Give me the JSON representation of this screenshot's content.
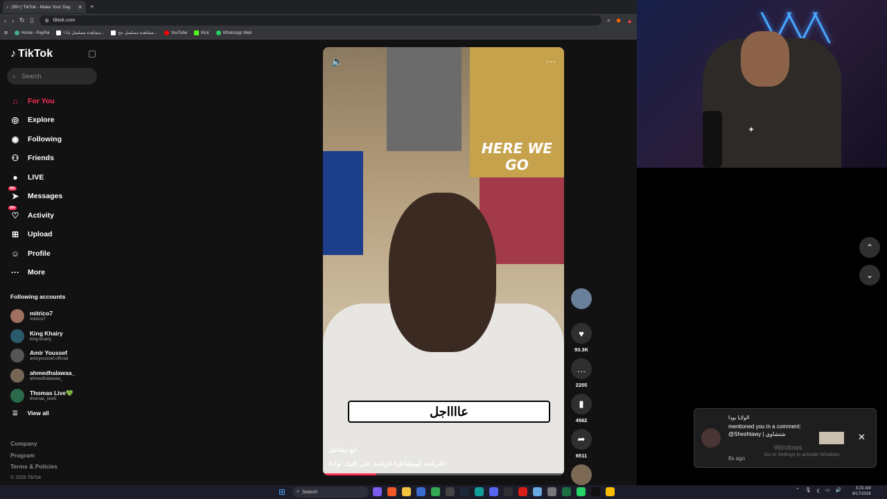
{
  "browser": {
    "tab_title": "(99+) TikTok - Make Your Day",
    "url": "tiktok.com",
    "bookmarks": [
      "Home - PayPal",
      "مشاهدة مسلسل بابا ا...",
      "مشاهدة مسلسل جح...",
      "YouTube",
      "Kick",
      "WhatsApp Web"
    ]
  },
  "sidebar": {
    "logo": "TikTok",
    "search_placeholder": "Search",
    "nav": [
      {
        "label": "For You",
        "icon": "home-icon",
        "active": true
      },
      {
        "label": "Explore",
        "icon": "compass-icon"
      },
      {
        "label": "Following",
        "icon": "following-icon"
      },
      {
        "label": "Friends",
        "icon": "friends-icon"
      },
      {
        "label": "LIVE",
        "icon": "live-icon"
      },
      {
        "label": "Messages",
        "icon": "messages-icon",
        "badge": "99+"
      },
      {
        "label": "Activity",
        "icon": "activity-icon",
        "badge": "99+"
      },
      {
        "label": "Upload",
        "icon": "upload-icon"
      },
      {
        "label": "Profile",
        "icon": "profile-icon"
      },
      {
        "label": "More",
        "icon": "more-icon"
      }
    ],
    "following_title": "Following accounts",
    "accounts": [
      {
        "name": "mitrico7",
        "handle": "mitrico7"
      },
      {
        "name": "King Khairy",
        "handle": "king.khairy"
      },
      {
        "name": "Amir Youssef",
        "handle": "amiryoussef.official"
      },
      {
        "name": "ahmedhalawaa_",
        "handle": "ahmedhalawaa_"
      },
      {
        "name": "Thomas Live💚",
        "handle": "thomas_live5"
      }
    ],
    "view_all": "View all",
    "footer": [
      "Company",
      "Program",
      "Terms & Policies"
    ],
    "copyright": "© 2026 TikTok"
  },
  "video": {
    "poster_text": "HERE WE GO",
    "caption": "عااااجل",
    "author": "ابو مشاعل",
    "hashtags": "#الرياضة_أبومشاعل# الرياضة_على_التيك_توك#",
    "progress": 0.22
  },
  "actions": {
    "likes": "93.3K",
    "comments": "2205",
    "saves": "4562",
    "shares": "6511"
  },
  "notification": {
    "line1": "الولايا بودا",
    "line2": "mentioned you in a comment: @Sheshtawy | شتشاوي",
    "time": "8s ago"
  },
  "watermark": {
    "title": "Windows",
    "subtitle": "Go to Settings to activate Windows."
  },
  "taskbar": {
    "search": "Search",
    "time": "3:23 AM",
    "date": "8/17/2026"
  }
}
